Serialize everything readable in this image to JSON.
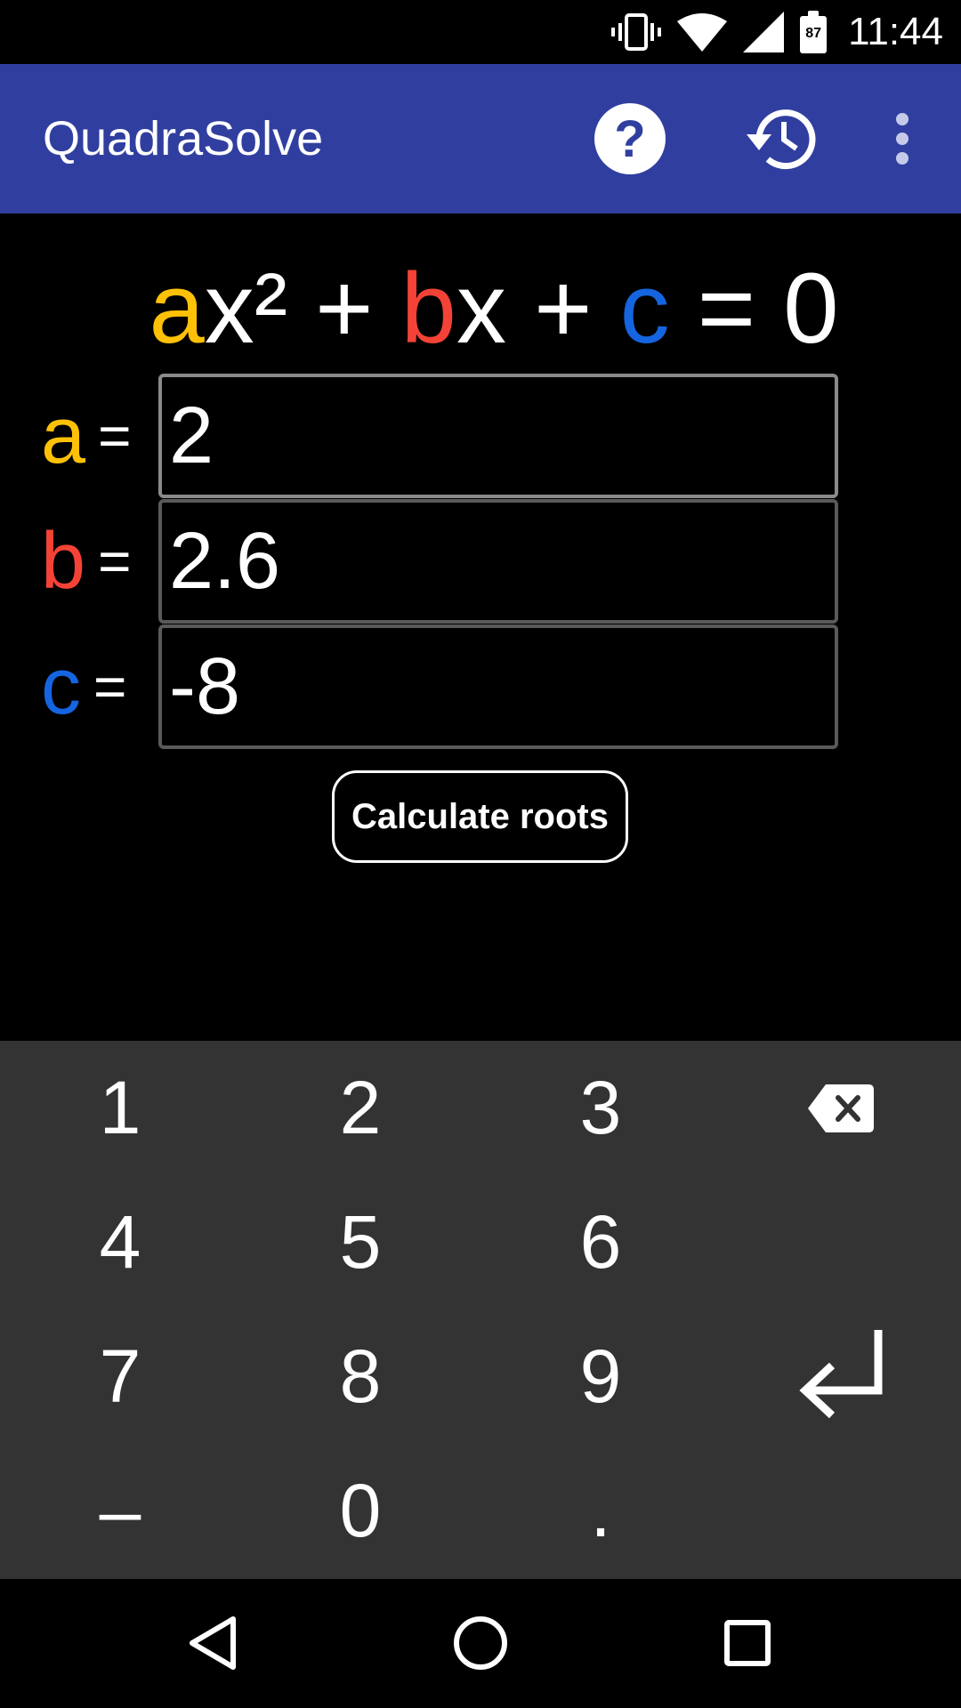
{
  "status_bar": {
    "time": "11:44",
    "battery_level": "87",
    "icons": [
      "vibrate-icon",
      "wifi-icon",
      "cell-signal-icon",
      "battery-icon"
    ]
  },
  "app_bar": {
    "title": "QuadraSolve",
    "actions": [
      "help-icon",
      "history-icon",
      "overflow-menu-icon"
    ],
    "color": "#303f9f"
  },
  "equation": {
    "a": "a",
    "x2": "x² + ",
    "b": "b",
    "x": "x + ",
    "c": "c",
    "rhs": " = 0"
  },
  "inputs": [
    {
      "label": "a",
      "eq": "=",
      "value": "2",
      "color": "#ffc107"
    },
    {
      "label": "b",
      "eq": "=",
      "value": "2.6",
      "color": "#f44336"
    },
    {
      "label": "c",
      "eq": "=",
      "value": "-8",
      "color": "#1565e0"
    }
  ],
  "calculate_button": "Calculate roots",
  "keypad": {
    "keys": [
      "1",
      "2",
      "3",
      "4",
      "5",
      "6",
      "7",
      "8",
      "9",
      "–",
      "0",
      "."
    ],
    "icons": [
      "backspace-icon",
      "enter-icon"
    ]
  },
  "nav_bar": {
    "icons": [
      "back-icon",
      "home-icon",
      "recents-icon"
    ]
  }
}
